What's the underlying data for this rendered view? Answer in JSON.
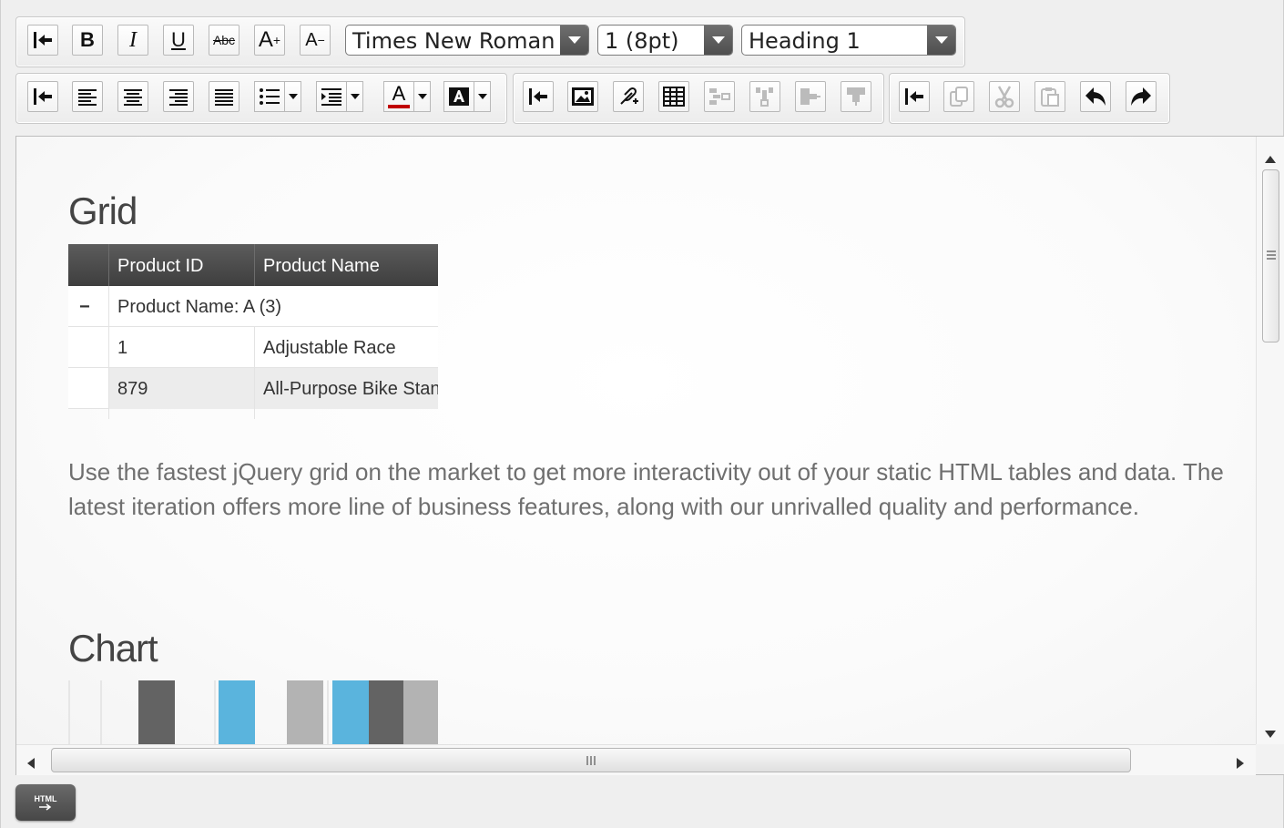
{
  "toolbar": {
    "font_family_value": "Times New Roman",
    "font_size_value": "1 (8pt)",
    "format_value": "Heading 1",
    "bold_label": "B",
    "italic_label": "I",
    "underline_label": "U",
    "strike_label": "Abc",
    "grow_label": "A",
    "grow_sup": "+",
    "shrink_label": "A",
    "shrink_sup": "−",
    "font_color_label": "A",
    "font_color": "#c00000"
  },
  "content": {
    "grid_heading": "Grid",
    "grid": {
      "columns": [
        "Product ID",
        "Product Name"
      ],
      "group_toggle": "−",
      "group_label": "Product Name: A (3)",
      "rows": [
        {
          "id": "1",
          "name": "Adjustable Race"
        },
        {
          "id": "879",
          "name": "All-Purpose Bike Stand"
        }
      ]
    },
    "paragraph_line1": "Use the fastest jQuery grid on the market to get more interactivity out of your static HTML tables and data. The",
    "paragraph_line2": "latest iteration offers more line of business features, along with our unrivalled quality and performance.",
    "chart_heading": "Chart"
  },
  "html_button_label": "HTML",
  "colors": {
    "chart_dark": "#636363",
    "chart_blue": "#5ab4dd",
    "chart_light": "#b3b3b3"
  }
}
